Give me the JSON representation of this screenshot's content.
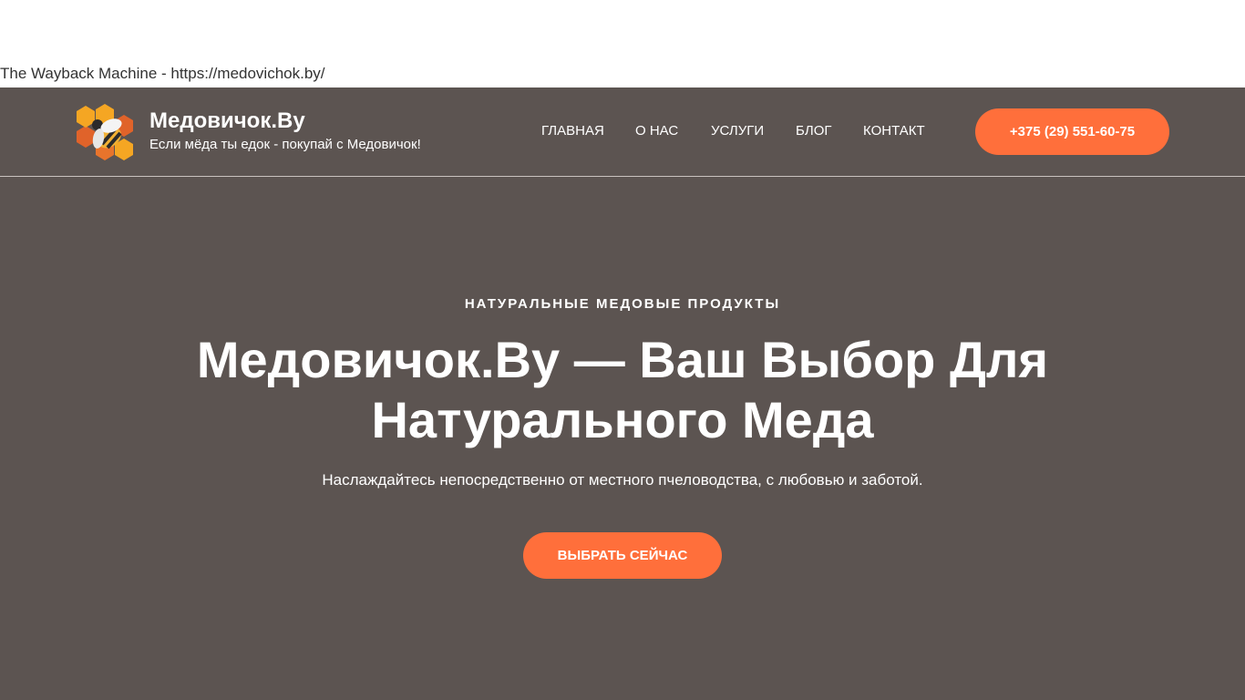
{
  "wayback": {
    "text": "The Wayback Machine - https://medovichok.by/"
  },
  "header": {
    "logo_icon": "bee-honeycomb-logo-icon",
    "brand_title": "Медовичок.Ву",
    "brand_tagline": "Если мёда ты едок - покупай с Медовичок!",
    "nav": [
      {
        "label": "ГЛАВНАЯ"
      },
      {
        "label": "О НАС"
      },
      {
        "label": "УСЛУГИ"
      },
      {
        "label": "БЛОГ"
      },
      {
        "label": "КОНТАКТ"
      }
    ],
    "phone_label": "+375 (29) 551-60-75"
  },
  "hero": {
    "eyebrow": "НАТУРАЛЬНЫЕ МЕДОВЫЕ ПРОДУКТЫ",
    "title": "Медовичок.Ву — Ваш Выбор Для Натурального Меда",
    "subtitle": "Наслаждайтесь непосредственно от местного пчеловодства, с любовью и заботой.",
    "cta_label": "ВЫБРАТЬ СЕЙЧАС"
  },
  "colors": {
    "background": "#5c5451",
    "accent": "#ff6f3b",
    "honey_light": "#f5a623",
    "honey_dark": "#e0632a"
  }
}
